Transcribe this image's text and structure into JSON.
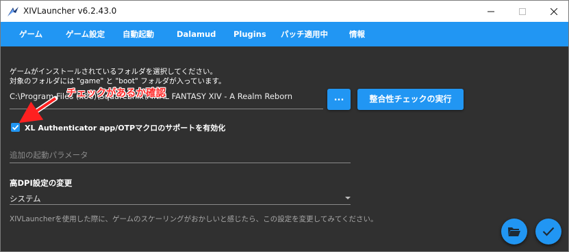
{
  "window": {
    "title": "XIVLauncher v6.2.43.0",
    "controls": {
      "minimize": "minimize-icon",
      "maximize": "maximize-icon",
      "close": "close-icon"
    }
  },
  "tabs": [
    {
      "label": "ゲーム"
    },
    {
      "label": "ゲーム設定"
    },
    {
      "label": "自動起動"
    },
    {
      "label": "Dalamud"
    },
    {
      "label": "Plugins"
    },
    {
      "label": "パッチ適用中"
    },
    {
      "label": "情報"
    }
  ],
  "game_folder": {
    "description_line1": "ゲームがインストールされているフォルダを選択してください。",
    "description_line2": "対象のフォルダには \"game\" と \"boot\" フォルダが入っています。",
    "path_value": "C:\\Program Files (x86)\\SquareEnix\\FINAL FANTASY XIV - A Realm Reborn",
    "browse_label": "...",
    "integrity_label": "整合性チェックの実行"
  },
  "otp": {
    "label": "XL Authenticator app/OTPマクロのサポートを有効化",
    "checked": true
  },
  "launch_params": {
    "placeholder": "追加の起動パラメータ",
    "value": ""
  },
  "dpi": {
    "title": "高DPI設定の変更",
    "selected": "システム",
    "hint": "XIVLauncherを使用した際に、ゲームのスケーリングがおかしいと感じたら、この設定を変更してみてください。"
  },
  "actions": {
    "open_folder_icon": "folder-open-icon",
    "save_icon": "check-icon"
  },
  "annotation": {
    "text": "チェックがあるか確認",
    "color": "#ff2a2a"
  },
  "colors": {
    "accent": "#2196f3",
    "background": "#303030"
  }
}
